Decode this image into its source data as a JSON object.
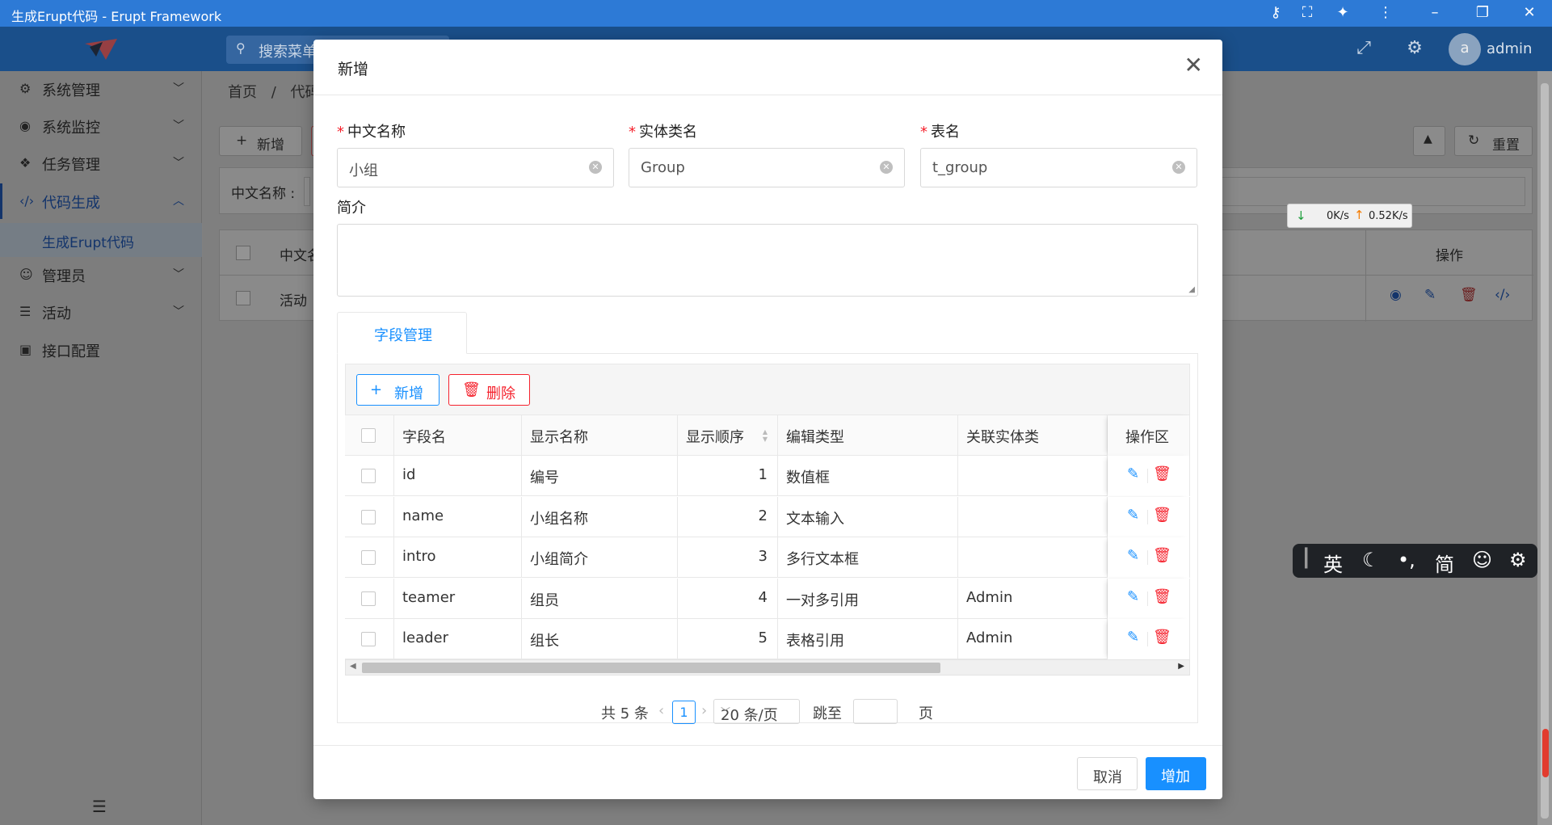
{
  "window": {
    "title": "生成Erupt代码 - Erupt Framework"
  },
  "header": {
    "search_placeholder": "搜索菜单",
    "avatar_letter": "a",
    "user": "admin"
  },
  "sidebar": {
    "items": [
      {
        "label": "系统管理",
        "icon": "gear-cluster-icon"
      },
      {
        "label": "系统监控",
        "icon": "monitor-icon"
      },
      {
        "label": "任务管理",
        "icon": "cubes-icon"
      },
      {
        "label": "代码生成",
        "icon": "code-icon"
      },
      {
        "label": "管理员",
        "icon": "user-icon"
      },
      {
        "label": "活动",
        "icon": "list-icon"
      },
      {
        "label": "接口配置",
        "icon": "box-icon"
      }
    ],
    "sub_item": "生成Erupt代码"
  },
  "background": {
    "breadcrumb_home": "首页",
    "breadcrumb_sep": "/",
    "breadcrumb_current": "代码",
    "add_label": "新增",
    "reset_label": "重置",
    "filter_label": "中文名称 :",
    "col_name": "中文名",
    "col_ops": "操作",
    "row_name": "活动"
  },
  "netmeter": {
    "down": "0K/s",
    "up": "0.52K/s"
  },
  "ime": {
    "lang": "英",
    "mode": "简"
  },
  "modal": {
    "title": "新增",
    "fields": {
      "cn_name": {
        "label": "中文名称",
        "value": "小组"
      },
      "class_name": {
        "label": "实体类名",
        "value": "Group"
      },
      "table_name": {
        "label": "表名",
        "value": "t_group"
      },
      "intro": {
        "label": "简介",
        "value": ""
      }
    },
    "tab_label": "字段管理",
    "toolbar": {
      "add": "新增",
      "delete": "删除"
    },
    "columns": [
      "字段名",
      "显示名称",
      "显示顺序",
      "编辑类型",
      "关联实体类",
      "操作区"
    ],
    "rows": [
      {
        "field": "id",
        "display": "编号",
        "order": "1",
        "edit_type": "数值框",
        "ref": ""
      },
      {
        "field": "name",
        "display": "小组名称",
        "order": "2",
        "edit_type": "文本输入",
        "ref": ""
      },
      {
        "field": "intro",
        "display": "小组简介",
        "order": "3",
        "edit_type": "多行文本框",
        "ref": ""
      },
      {
        "field": "teamer",
        "display": "组员",
        "order": "4",
        "edit_type": "一对多引用",
        "ref": "Admin"
      },
      {
        "field": "leader",
        "display": "组长",
        "order": "5",
        "edit_type": "表格引用",
        "ref": "Admin"
      }
    ],
    "pager": {
      "total": "共 5 条",
      "page": "1",
      "size": "20 条/页",
      "jump": "跳至",
      "unit": "页"
    },
    "footer": {
      "cancel": "取消",
      "ok": "增加"
    }
  },
  "colors": {
    "primary": "#1890ff",
    "danger": "#f5222d",
    "titlebar": "#2d7ad6"
  }
}
